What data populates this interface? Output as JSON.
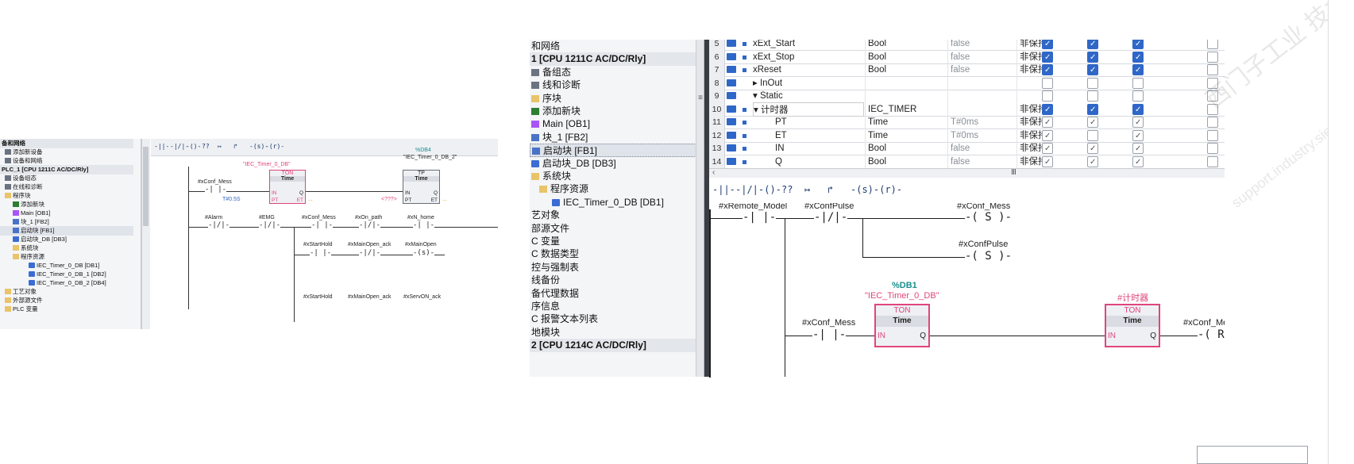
{
  "left": {
    "tree": [
      {
        "label": "备和网络",
        "kind": "hdr"
      },
      {
        "label": "添加新设备",
        "kind": "dev"
      },
      {
        "label": "设备和网络",
        "kind": "dev"
      },
      {
        "label": "PLC_1 [CPU 1211C AC/DC/Rly]",
        "kind": "hdr"
      },
      {
        "label": "设备组态",
        "kind": "dev"
      },
      {
        "label": "在线和诊断",
        "kind": "dev"
      },
      {
        "label": "程序块",
        "kind": "folder"
      },
      {
        "label": "添加新块",
        "kind": "add"
      },
      {
        "label": "Main [OB1]",
        "kind": "ob"
      },
      {
        "label": "块_1 [FB2]",
        "kind": "fb"
      },
      {
        "label": "启动块 [FB1]",
        "kind": "fb",
        "sel": true
      },
      {
        "label": "启动块_DB [DB3]",
        "kind": "db"
      },
      {
        "label": "系统块",
        "kind": "folder"
      },
      {
        "label": "程序资源",
        "kind": "folder"
      },
      {
        "label": "IEC_Timer_0_DB [DB1]",
        "kind": "db"
      },
      {
        "label": "IEC_Timer_0_DB_1 [DB2]",
        "kind": "db"
      },
      {
        "label": "IEC_Timer_0_DB_2 [DB4]",
        "kind": "db"
      },
      {
        "label": "工艺对象",
        "kind": "folder"
      },
      {
        "label": "外部源文件",
        "kind": "folder"
      },
      {
        "label": "PLC 变量",
        "kind": "folder"
      }
    ],
    "toolbar": [
      "-||-",
      "-|/|-",
      "-()-",
      "??",
      "↦",
      "↱",
      "-(s)-",
      "-(r)-"
    ],
    "ladder": {
      "net1": {
        "contact": "#xConf_Mess",
        "ton_db": "\"IEC_Timer_0_DB\"",
        "ton_type": "TON",
        "ton_sub": "Time",
        "pt_value": "T#0.5S",
        "tp_db_addr": "%DB4",
        "tp_db": "\"IEC_Timer_0_DB_2\"",
        "tp_type": "TP",
        "tp_sub": "Time",
        "tp_pt": "<???>",
        "pin_in": "IN",
        "pin_q": "Q",
        "pin_pt": "PT",
        "pin_et": "ET",
        "et_out": "...",
        "tp_et_out": "..."
      },
      "net2": {
        "labels": [
          "#Alarm",
          "#EMG",
          "#xConf_Mess",
          "#xOn_path",
          "#xN_home"
        ],
        "branch1": [
          "#xStartHold",
          "#xMainOpen_ack",
          "#xMainOpen"
        ],
        "branch2": [
          "#xStartHold",
          "#xMainOpen_ack",
          "#xServON_ack"
        ]
      }
    }
  },
  "right": {
    "tree": [
      {
        "label": "和网络",
        "kind": "plain"
      },
      {
        "label": "1 [CPU 1211C AC/DC/Rly]",
        "kind": "hdr"
      },
      {
        "label": "备组态",
        "kind": "dev"
      },
      {
        "label": "线和诊断",
        "kind": "dev"
      },
      {
        "label": "序块",
        "kind": "folder"
      },
      {
        "label": "添加新块",
        "kind": "add"
      },
      {
        "label": "Main [OB1]",
        "kind": "ob"
      },
      {
        "label": "块_1 [FB2]",
        "kind": "fb"
      },
      {
        "label": "启动块 [FB1]",
        "kind": "fb",
        "sel": true
      },
      {
        "label": "启动块_DB [DB3]",
        "kind": "db"
      },
      {
        "label": "系统块",
        "kind": "folder"
      },
      {
        "label": "程序资源",
        "kind": "folder"
      },
      {
        "label": "IEC_Timer_0_DB [DB1]",
        "kind": "db"
      },
      {
        "label": "艺对象",
        "kind": "plain"
      },
      {
        "label": "部源文件",
        "kind": "plain"
      },
      {
        "label": "C 变量",
        "kind": "plain"
      },
      {
        "label": "C 数据类型",
        "kind": "plain"
      },
      {
        "label": "控与强制表",
        "kind": "plain"
      },
      {
        "label": "线备份",
        "kind": "plain"
      },
      {
        "label": "备代理数据",
        "kind": "plain"
      },
      {
        "label": "序信息",
        "kind": "plain"
      },
      {
        "label": "C 报警文本列表",
        "kind": "plain"
      },
      {
        "label": "地模块",
        "kind": "plain"
      },
      {
        "label": "2 [CPU 1214C AC/DC/Rly]",
        "kind": "hdr"
      }
    ],
    "table_rows": [
      {
        "num": "5",
        "name": "xExt_Start",
        "type": "Bool",
        "def": "false",
        "ret": "非保持",
        "c": [
          true,
          true,
          true,
          false
        ],
        "grey": false
      },
      {
        "num": "6",
        "name": "xExt_Stop",
        "type": "Bool",
        "def": "false",
        "ret": "非保持",
        "c": [
          true,
          true,
          true,
          false
        ],
        "grey": false
      },
      {
        "num": "7",
        "name": "xReset",
        "type": "Bool",
        "def": "false",
        "ret": "非保持",
        "c": [
          true,
          true,
          true,
          false
        ],
        "grey": false
      },
      {
        "num": "8",
        "name": "▸ InOut",
        "type": "",
        "def": "",
        "ret": "",
        "c": [
          false,
          false,
          false,
          false
        ],
        "grey": false,
        "section": true
      },
      {
        "num": "9",
        "name": "▾ Static",
        "type": "",
        "def": "",
        "ret": "",
        "c": [
          false,
          false,
          false,
          false
        ],
        "grey": false,
        "section": true
      },
      {
        "num": "10",
        "name": "▾ 计时器",
        "type": "IEC_TIMER",
        "def": "",
        "ret": "非保持",
        "c": [
          true,
          true,
          true,
          false
        ],
        "grey": false,
        "sel": true
      },
      {
        "num": "11",
        "name": "PT",
        "type": "Time",
        "def": "T#0ms",
        "ret": "非保持",
        "c": [
          true,
          true,
          true,
          false
        ],
        "grey": true,
        "indent": true
      },
      {
        "num": "12",
        "name": "ET",
        "type": "Time",
        "def": "T#0ms",
        "ret": "非保持",
        "c": [
          true,
          false,
          true,
          false
        ],
        "grey": true,
        "indent": true
      },
      {
        "num": "13",
        "name": "IN",
        "type": "Bool",
        "def": "false",
        "ret": "非保持",
        "c": [
          true,
          true,
          true,
          false
        ],
        "grey": true,
        "indent": true
      },
      {
        "num": "14",
        "name": "Q",
        "type": "Bool",
        "def": "false",
        "ret": "非保持",
        "c": [
          true,
          true,
          true,
          false
        ],
        "grey": true,
        "indent": true
      }
    ],
    "toolbar": [
      "-||-",
      "-|/|-",
      "-()-",
      "??",
      "↦",
      "↱",
      "-(s)-",
      "-(r)-"
    ],
    "ladder": {
      "net1": {
        "c1": "#xRemote_Model",
        "c2": "#xConfPulse",
        "coil1_label": "#xConf_Mess",
        "coil1": "S",
        "coil2_label": "#xConfPulse",
        "coil2": "S"
      },
      "net2": {
        "contact": "#xConf_Mess",
        "ton1_addr": "%DB1",
        "ton1_db": "\"IEC_Timer_0_DB\"",
        "ton_type": "TON",
        "ton_sub": "Time",
        "ton2_db": "#计时器",
        "coil_label": "#xConf_Mess",
        "coil": "R",
        "pin_in": "IN",
        "pin_q": "Q"
      }
    },
    "watermark": "西门子工业  技术论坛",
    "watermark_sub": "support.industry.siemens.com/cs"
  },
  "colors": {
    "accent": "#2f67c8",
    "timer_border": "#e0457b",
    "addr": "#1a8f8f"
  }
}
